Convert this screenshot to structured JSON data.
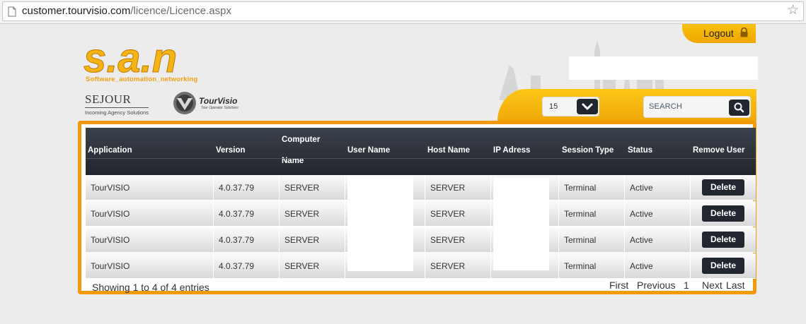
{
  "browser": {
    "url_domain": "customer.tourvisio.com",
    "url_path": "/licence/Licence.aspx"
  },
  "header": {
    "logo_text": "s.a.n",
    "logo_tagline": "Software_automation_networking",
    "sejour_name": "SEJOUR",
    "sejour_sub": "Incoming Agency Solutions",
    "tourvisio_name": "TourVisio",
    "tourvisio_sub": "Tour Operator Solutions",
    "logout_label": "Logout"
  },
  "controls": {
    "page_size": "15",
    "search_placeholder": "SEARCH"
  },
  "table": {
    "columns": [
      "Application",
      "Version",
      "Computer Name",
      "User Name",
      "Host Name",
      "IP Adress",
      "Session Type",
      "Status",
      "Remove User"
    ],
    "computer_name_line1": "Computer",
    "computer_name_line2": "Name",
    "rows": [
      {
        "application": "TourVISIO",
        "version": "4.0.37.79",
        "computer": "SERVER",
        "user": "",
        "host": "SERVER",
        "ip": "",
        "session": "Terminal",
        "status": "Active",
        "action": "Delete"
      },
      {
        "application": "TourVISIO",
        "version": "4.0.37.79",
        "computer": "SERVER",
        "user": "",
        "host": "SERVER",
        "ip": "",
        "session": "Terminal",
        "status": "Active",
        "action": "Delete"
      },
      {
        "application": "TourVISIO",
        "version": "4.0.37.79",
        "computer": "SERVER",
        "user": "",
        "host": "SERVER",
        "ip": "",
        "session": "Terminal",
        "status": "Active",
        "action": "Delete"
      },
      {
        "application": "TourVISIO",
        "version": "4.0.37.79",
        "computer": "SERVER",
        "user": "",
        "host": "SERVER",
        "ip": "",
        "session": "Terminal",
        "status": "Active",
        "action": "Delete"
      }
    ]
  },
  "footer": {
    "info": "Showing 1 to 4 of 4 entries",
    "first": "First",
    "previous": "Previous",
    "page": "1",
    "next": "Next",
    "last": "Last"
  },
  "colors": {
    "accent_orange": "#f29a0a",
    "header_dark": "#22262e",
    "logo_gold": "#f4b416"
  }
}
